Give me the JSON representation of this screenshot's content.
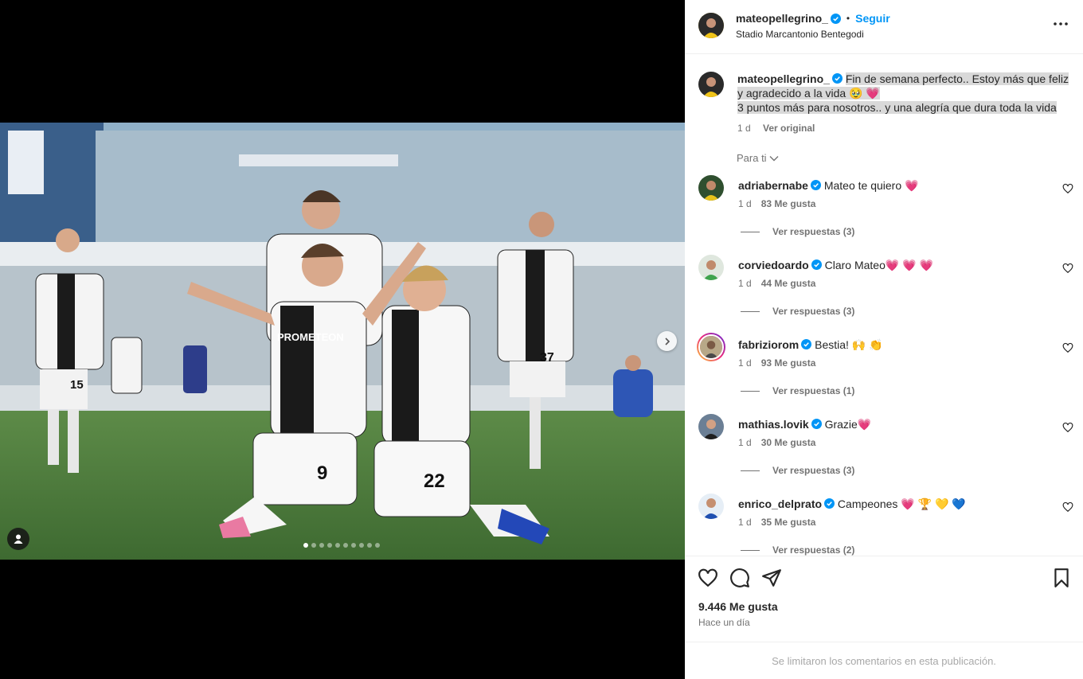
{
  "post": {
    "username": "mateopellegrino_",
    "follow_label": "Seguir",
    "location": "Stadio Marcantonio Bentegodi",
    "more_icon": "more-options-icon"
  },
  "caption": {
    "username": "mateopellegrino_",
    "line1": "Fin de semana perfecto.. Estoy más que feliz y agradecido a la vida 🥹 💗",
    "line2": "3 puntos más para nosotros.. y una alegría que dura toda la vida",
    "time": "1 d",
    "see_original": "Ver original"
  },
  "for_you_label": "Para ti",
  "comments": [
    {
      "username": "adriabernabe",
      "text": "Mateo te quiero 💗",
      "time": "1 d",
      "likes": "83 Me gusta",
      "replies": "Ver respuestas (3)"
    },
    {
      "username": "corviedoardo",
      "text": "Claro Mateo💗 💗 💗",
      "time": "1 d",
      "likes": "44 Me gusta",
      "replies": "Ver respuestas (3)"
    },
    {
      "username": "fabriziorom",
      "text": "Bestia! 🙌 👏",
      "time": "1 d",
      "likes": "93 Me gusta",
      "replies": "Ver respuestas (1)"
    },
    {
      "username": "mathias.lovik",
      "text": "Grazie💗",
      "time": "1 d",
      "likes": "30 Me gusta",
      "replies": "Ver respuestas (3)"
    },
    {
      "username": "enrico_delprato",
      "text": "Campeones 💗 🏆 💛 💙",
      "time": "1 d",
      "likes": "35 Me gusta",
      "replies": "Ver respuestas (2)"
    }
  ],
  "actions": {
    "like_icon": "heart-icon",
    "comment_icon": "comment-icon",
    "share_icon": "share-icon",
    "save_icon": "bookmark-icon"
  },
  "likes_count": "9.446 Me gusta",
  "posted_time": "Hace un día",
  "comments_limited": "Se limitaron los comentarios en esta publicación.",
  "carousel": {
    "slides": 10,
    "active": 0
  },
  "photo_text": {
    "sponsor": "PROMETEON",
    "number_9": "9",
    "number_22": "22",
    "number_37": "37",
    "number_15": "15"
  },
  "colors": {
    "accent": "#0095f6",
    "verified": "#0095f6",
    "text": "#262626",
    "muted": "#737373",
    "heart": "#ed4956"
  }
}
